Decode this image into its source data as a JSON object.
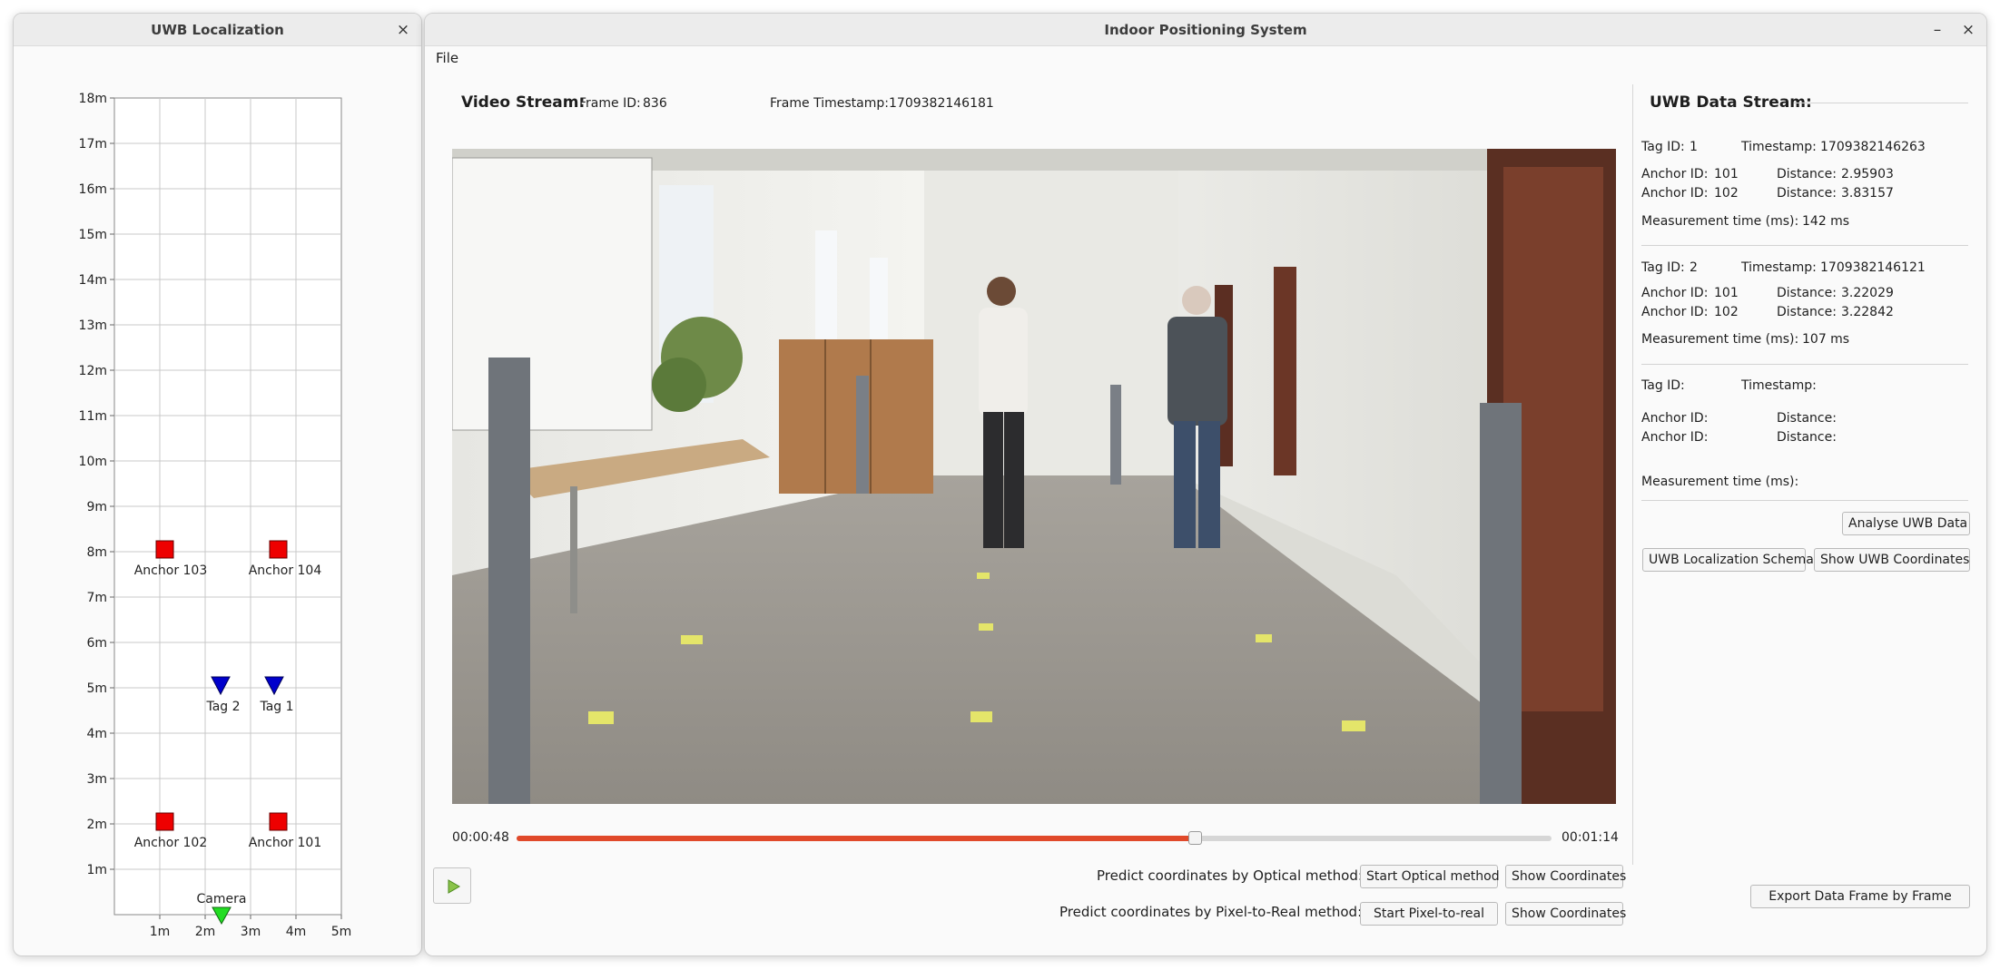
{
  "uwb_window": {
    "title": "UWB Localization",
    "close_icon": "×",
    "y_ticks": [
      "18m",
      "17m",
      "16m",
      "15m",
      "14m",
      "13m",
      "12m",
      "11m",
      "10m",
      "9m",
      "8m",
      "7m",
      "6m",
      "5m",
      "4m",
      "3m",
      "2m",
      "1m"
    ],
    "x_ticks": [
      "1m",
      "2m",
      "3m",
      "4m",
      "5m"
    ],
    "anchor_labels": [
      "Anchor 103",
      "Anchor 104",
      "Anchor 102",
      "Anchor 101"
    ],
    "tag_labels": [
      "Tag 2",
      "Tag 1"
    ],
    "camera_label": "Camera",
    "colors": {
      "anchor": "#ee0000",
      "tag": "#0000cc",
      "camera": "#22dd22"
    }
  },
  "main_window": {
    "title": "Indoor Positioning System",
    "minimize_icon": "–",
    "close_icon": "×",
    "menu": [
      "File"
    ],
    "video_stream_label": "Video Stream:",
    "frame_id_label": "Frame ID:",
    "frame_id": "836",
    "frame_ts_label": "Frame Timestamp:",
    "frame_ts": "1709382146181",
    "time_current": "00:00:48",
    "time_total": "00:01:14",
    "progress": 0.655,
    "optical_label": "Predict coordinates by Optical method:",
    "optical_start": "Start Optical method",
    "optical_show": "Show Coordinates",
    "p2r_label": "Predict coordinates by Pixel-to-Real method:",
    "p2r_start": "Start Pixel-to-real",
    "p2r_show": "Show Coordinates",
    "accent_color": "#e0492a"
  },
  "uwb_stream": {
    "heading": "UWB Data Stream:",
    "tag_label": "Tag ID:",
    "ts_label": "Timestamp:",
    "anchor_label": "Anchor ID:",
    "dist_label": "Distance:",
    "meas_label": "Measurement time (ms):",
    "blocks": [
      {
        "tag": "1",
        "timestamp": "1709382146263",
        "a1": "101",
        "d1": "2.95903",
        "a2": "102",
        "d2": "3.83157",
        "meas": "142 ms"
      },
      {
        "tag": "2",
        "timestamp": "1709382146121",
        "a1": "101",
        "d1": "3.22029",
        "a2": "102",
        "d2": "3.22842",
        "meas": "107 ms"
      },
      {
        "tag": "",
        "timestamp": "",
        "a1": "",
        "d1": "",
        "a2": "",
        "d2": "",
        "meas": ""
      }
    ],
    "analyse_btn": "Analyse UWB Data",
    "schema_btn": "UWB Localization Schema",
    "show_btn": "Show UWB Coordinates",
    "export_btn": "Export Data Frame by Frame"
  }
}
